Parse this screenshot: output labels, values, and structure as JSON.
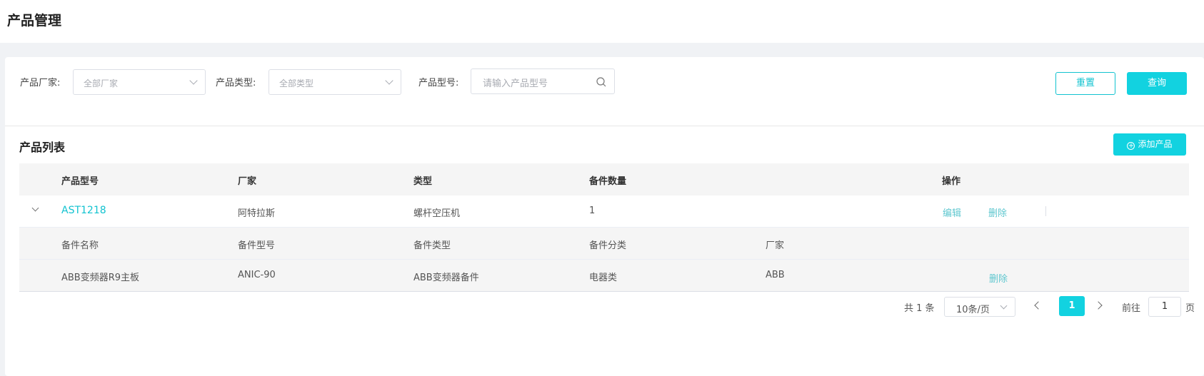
{
  "page": {
    "title": "产品管理"
  },
  "filters": {
    "manufacturer": {
      "label": "产品厂家:",
      "placeholder": "全部厂家"
    },
    "type": {
      "label": "产品类型:",
      "placeholder": "全部类型"
    },
    "model": {
      "label": "产品型号:",
      "placeholder": "请输入产品型号"
    },
    "reset_label": "重置",
    "query_label": "查询"
  },
  "list": {
    "title": "产品列表",
    "add_label": "添加产品"
  },
  "table": {
    "headers": [
      "产品型号",
      "厂家",
      "类型",
      "备件数量",
      "操作"
    ],
    "rows": [
      {
        "model": "AST1218",
        "manufacturer": "阿特拉斯",
        "type": "螺杆空压机",
        "spare_count": "1",
        "edit_label": "编辑",
        "delete_label": "删除",
        "sub_headers": [
          "备件名称",
          "备件型号",
          "备件类型",
          "备件分类",
          "厂家"
        ],
        "spares": [
          {
            "name": "ABB变频器R9主板",
            "model": "ANIC-90",
            "type": "ABB变频器备件",
            "category": "电器类",
            "manufacturer": "ABB",
            "delete_label": "删除"
          }
        ]
      }
    ]
  },
  "pagination": {
    "total_text": "共 1 条",
    "page_size": "10条/页",
    "current_page": "1",
    "goto_label": "前往",
    "goto_value": "1",
    "page_suffix": "页"
  },
  "colors": {
    "accent": "#12d2e0",
    "link": "#12c3d0",
    "background": "#f0f2f5"
  }
}
